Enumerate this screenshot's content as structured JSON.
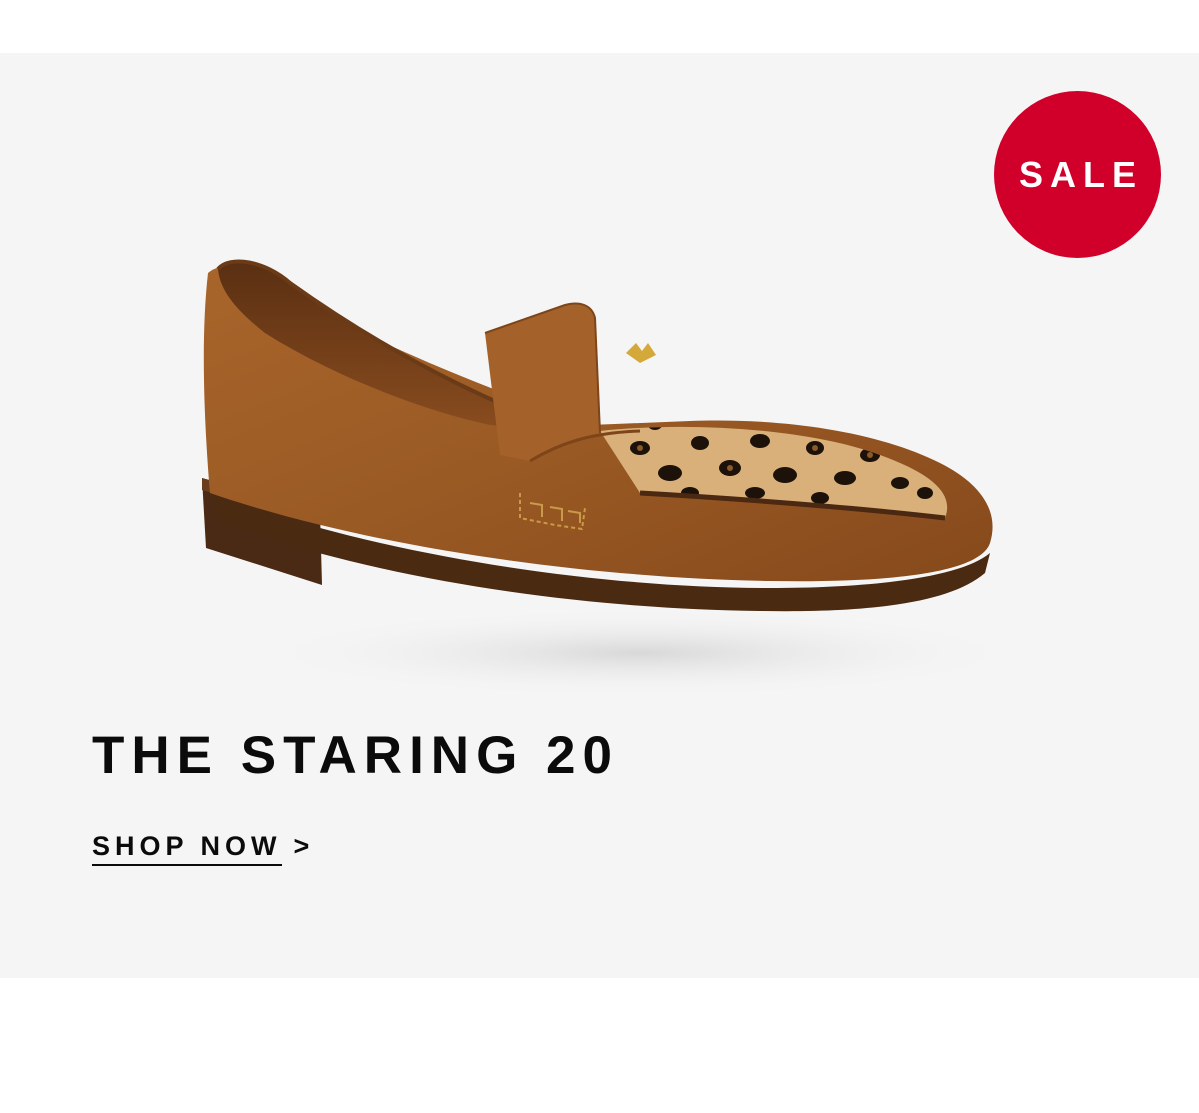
{
  "badge": {
    "label": "SALE",
    "color": "#d0002a"
  },
  "product": {
    "name": "THE STARING 20",
    "image_icon": "leopard-calf-hair-loafer-image"
  },
  "cta": {
    "label": "SHOP NOW",
    "arrow": ">"
  },
  "colors": {
    "panel_background": "#f5f5f5",
    "text": "#0b0b0b"
  }
}
